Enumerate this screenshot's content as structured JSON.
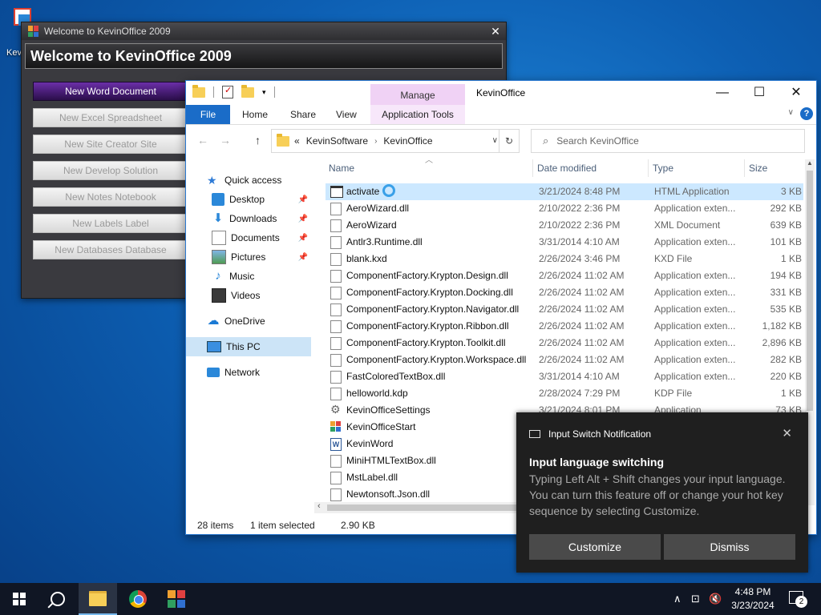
{
  "desktop": {
    "icon_label": "Kevi"
  },
  "kevinoffice": {
    "window_title": "Welcome to KevinOffice 2009",
    "header": "Welcome to KevinOffice 2009",
    "buttons": [
      "New Word Document",
      "New Excel Spreadsheet",
      "New Site Creator Site",
      "New Develop Solution",
      "New Notes Notebook",
      "New Labels Label",
      "New Databases Database"
    ]
  },
  "explorer": {
    "window_title": "KevinOffice",
    "manage_tab": "Manage",
    "ribbon_tabs": {
      "file": "File",
      "home": "Home",
      "share": "Share",
      "view": "View",
      "app_tools": "Application Tools"
    },
    "address": {
      "prefix": "«",
      "crumbs": [
        "KevinSoftware",
        "KevinOffice"
      ]
    },
    "search_placeholder": "Search KevinOffice",
    "nav": {
      "quick_access": "Quick access",
      "desktop": "Desktop",
      "downloads": "Downloads",
      "documents": "Documents",
      "pictures": "Pictures",
      "music": "Music",
      "videos": "Videos",
      "onedrive": "OneDrive",
      "this_pc": "This PC",
      "network": "Network"
    },
    "columns": {
      "name": "Name",
      "date": "Date modified",
      "type": "Type",
      "size": "Size"
    },
    "files": [
      {
        "name": "activate",
        "date": "3/21/2024 8:48 PM",
        "type": "HTML Application",
        "size": "3 KB",
        "icon": "html-app-icon"
      },
      {
        "name": "AeroWizard.dll",
        "date": "2/10/2022 2:36 PM",
        "type": "Application exten...",
        "size": "292 KB",
        "icon": "dll-icon"
      },
      {
        "name": "AeroWizard",
        "date": "2/10/2022 2:36 PM",
        "type": "XML Document",
        "size": "639 KB",
        "icon": "xml-icon"
      },
      {
        "name": "Antlr3.Runtime.dll",
        "date": "3/31/2014 4:10 AM",
        "type": "Application exten...",
        "size": "101 KB",
        "icon": "dll-icon"
      },
      {
        "name": "blank.kxd",
        "date": "2/26/2024 3:46 PM",
        "type": "KXD File",
        "size": "1 KB",
        "icon": "file-icon"
      },
      {
        "name": "ComponentFactory.Krypton.Design.dll",
        "date": "2/26/2024 11:02 AM",
        "type": "Application exten...",
        "size": "194 KB",
        "icon": "dll-icon"
      },
      {
        "name": "ComponentFactory.Krypton.Docking.dll",
        "date": "2/26/2024 11:02 AM",
        "type": "Application exten...",
        "size": "331 KB",
        "icon": "dll-icon"
      },
      {
        "name": "ComponentFactory.Krypton.Navigator.dll",
        "date": "2/26/2024 11:02 AM",
        "type": "Application exten...",
        "size": "535 KB",
        "icon": "dll-icon"
      },
      {
        "name": "ComponentFactory.Krypton.Ribbon.dll",
        "date": "2/26/2024 11:02 AM",
        "type": "Application exten...",
        "size": "1,182 KB",
        "icon": "dll-icon"
      },
      {
        "name": "ComponentFactory.Krypton.Toolkit.dll",
        "date": "2/26/2024 11:02 AM",
        "type": "Application exten...",
        "size": "2,896 KB",
        "icon": "dll-icon"
      },
      {
        "name": "ComponentFactory.Krypton.Workspace.dll",
        "date": "2/26/2024 11:02 AM",
        "type": "Application exten...",
        "size": "282 KB",
        "icon": "dll-icon"
      },
      {
        "name": "FastColoredTextBox.dll",
        "date": "3/31/2014 4:10 AM",
        "type": "Application exten...",
        "size": "220 KB",
        "icon": "dll-icon"
      },
      {
        "name": "helloworld.kdp",
        "date": "2/28/2024 7:29 PM",
        "type": "KDP File",
        "size": "1 KB",
        "icon": "file-icon"
      },
      {
        "name": "KevinOfficeSettings",
        "date": "3/21/2024 8:01 PM",
        "type": "Application",
        "size": "73 KB",
        "icon": "gear-icon"
      },
      {
        "name": "KevinOfficeStart",
        "date": "",
        "type": "",
        "size": "",
        "icon": "app-icon"
      },
      {
        "name": "KevinWord",
        "date": "",
        "type": "",
        "size": "",
        "icon": "word-icon"
      },
      {
        "name": "MiniHTMLTextBox.dll",
        "date": "",
        "type": "",
        "size": "",
        "icon": "dll-icon"
      },
      {
        "name": "MstLabel.dll",
        "date": "",
        "type": "",
        "size": "",
        "icon": "dll-icon"
      },
      {
        "name": "Newtonsoft.Json.dll",
        "date": "",
        "type": "",
        "size": "",
        "icon": "dll-icon"
      }
    ],
    "status": {
      "count": "28 items",
      "selection": "1 item selected",
      "size": "2.90 KB"
    }
  },
  "notification": {
    "header": "Input Switch Notification",
    "title": "Input language switching",
    "body": "Typing Left Alt + Shift changes your input language. You can turn this feature off or change your hot key sequence by selecting Customize.",
    "customize": "Customize",
    "dismiss": "Dismiss"
  },
  "taskbar": {
    "time": "4:48 PM",
    "date": "3/23/2024",
    "notification_count": "2"
  }
}
